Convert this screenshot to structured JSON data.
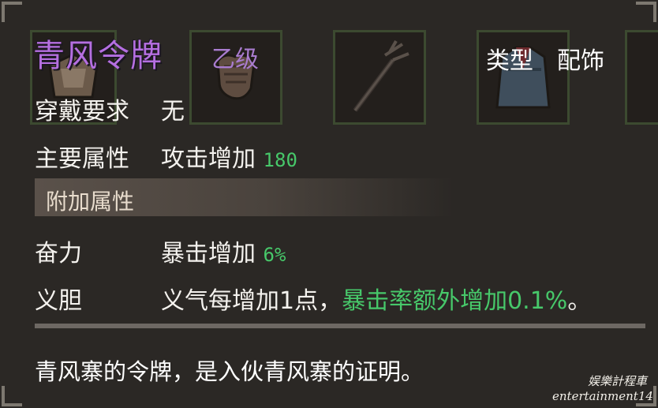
{
  "item": {
    "name": "青风令牌",
    "grade": "乙级",
    "type_label": "类型",
    "type_value": "配饰"
  },
  "requirement": {
    "label": "穿戴要求",
    "value": "无"
  },
  "main_attr": {
    "label": "主要属性",
    "value_text": "攻击增加",
    "value_num": "180"
  },
  "extra_section": {
    "label": "附加属性"
  },
  "extra_attrs": [
    {
      "label": "奋力",
      "value_text": "暴击增加",
      "value_num": "6%"
    },
    {
      "label": "义胆",
      "value_text": "义气每增加1点，",
      "value_bonus": "暴击率额外增加0.1%",
      "value_tail": "。"
    }
  ],
  "description": "青风寨的令牌，是入伙青风寨的证明。",
  "watermark": {
    "line1": "娱樂計程車",
    "line2": "entertainment14"
  },
  "slot_icons": [
    "bag-icon",
    "glove-icon",
    "trident-icon",
    "robe-icon"
  ],
  "colors": {
    "title": "#b56fe0",
    "grade": "#a97ccf",
    "bonus": "#47c86a",
    "slot_border": "#3c4a30"
  }
}
